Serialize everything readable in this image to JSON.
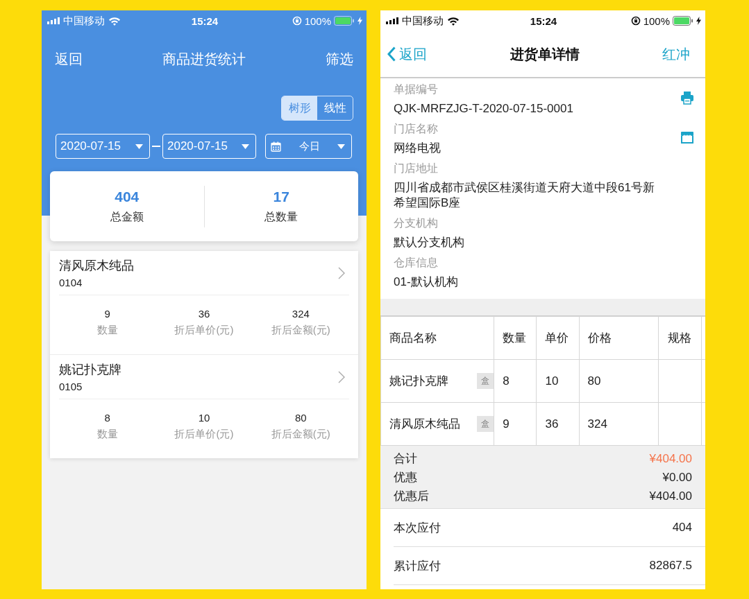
{
  "stats_screen": {
    "status_bar": {
      "carrier": "中国移动",
      "time": "15:24",
      "battery": "100%"
    },
    "nav": {
      "back": "返回",
      "title": "商品进货统计",
      "action": "筛选"
    },
    "view_toggle": [
      {
        "label": "树形",
        "selected": true
      },
      {
        "label": "线性",
        "selected": false
      }
    ],
    "date_range": {
      "start": "2020-07-15",
      "end": "2020-07-15",
      "period": "今日"
    },
    "summary": [
      {
        "value": "404",
        "label": "总金额"
      },
      {
        "value": "17",
        "label": "总数量"
      }
    ],
    "products": [
      {
        "name": "清风原木纯品",
        "code": "0104",
        "metrics": [
          {
            "value": "9",
            "label": "数量"
          },
          {
            "value": "36",
            "label": "折后单价(元)"
          },
          {
            "value": "324",
            "label": "折后金额(元)"
          }
        ]
      },
      {
        "name": "姚记扑克牌",
        "code": "0105",
        "metrics": [
          {
            "value": "8",
            "label": "数量"
          },
          {
            "value": "10",
            "label": "折后单价(元)"
          },
          {
            "value": "80",
            "label": "折后金额(元)"
          }
        ]
      }
    ]
  },
  "detail_screen": {
    "status_bar": {
      "carrier": "中国移动",
      "time": "15:24",
      "battery": "100%"
    },
    "nav": {
      "back": "返回",
      "title": "进货单详情",
      "action": "红冲"
    },
    "fields": [
      {
        "label": "单据编号",
        "value": "QJK-MRFZJG-T-2020-07-15-0001",
        "kind": "print"
      },
      {
        "label": "门店名称",
        "value": "网络电视",
        "kind": "store"
      },
      {
        "label": "门店地址",
        "value": "四川省成都市武侯区桂溪街道天府大道中段61号新希望国际B座",
        "kind": "text"
      },
      {
        "label": "分支机构",
        "value": "默认分支机构",
        "kind": "text"
      },
      {
        "label": "仓库信息",
        "value": "01-默认机构",
        "kind": "text"
      }
    ],
    "table": {
      "columns": [
        "商品名称",
        "数量",
        "单价",
        "价格",
        "规格"
      ],
      "rows": [
        {
          "name": "姚记扑克牌",
          "unit": "盒",
          "quantity": "8",
          "unit_price": "10",
          "price": "80"
        },
        {
          "name": "清风原木纯品",
          "unit": "盒",
          "quantity": "9",
          "unit_price": "36",
          "price": "324"
        }
      ]
    },
    "totals": [
      {
        "label": "合计",
        "value": "¥404.00",
        "highlight": true
      },
      {
        "label": "优惠",
        "value": "¥0.00",
        "highlight": false
      },
      {
        "label": "优惠后",
        "value": "¥404.00",
        "highlight": false
      }
    ],
    "payments": [
      {
        "label": "本次应付",
        "value": "404"
      },
      {
        "label": "累计应付",
        "value": "82867.5"
      }
    ]
  }
}
